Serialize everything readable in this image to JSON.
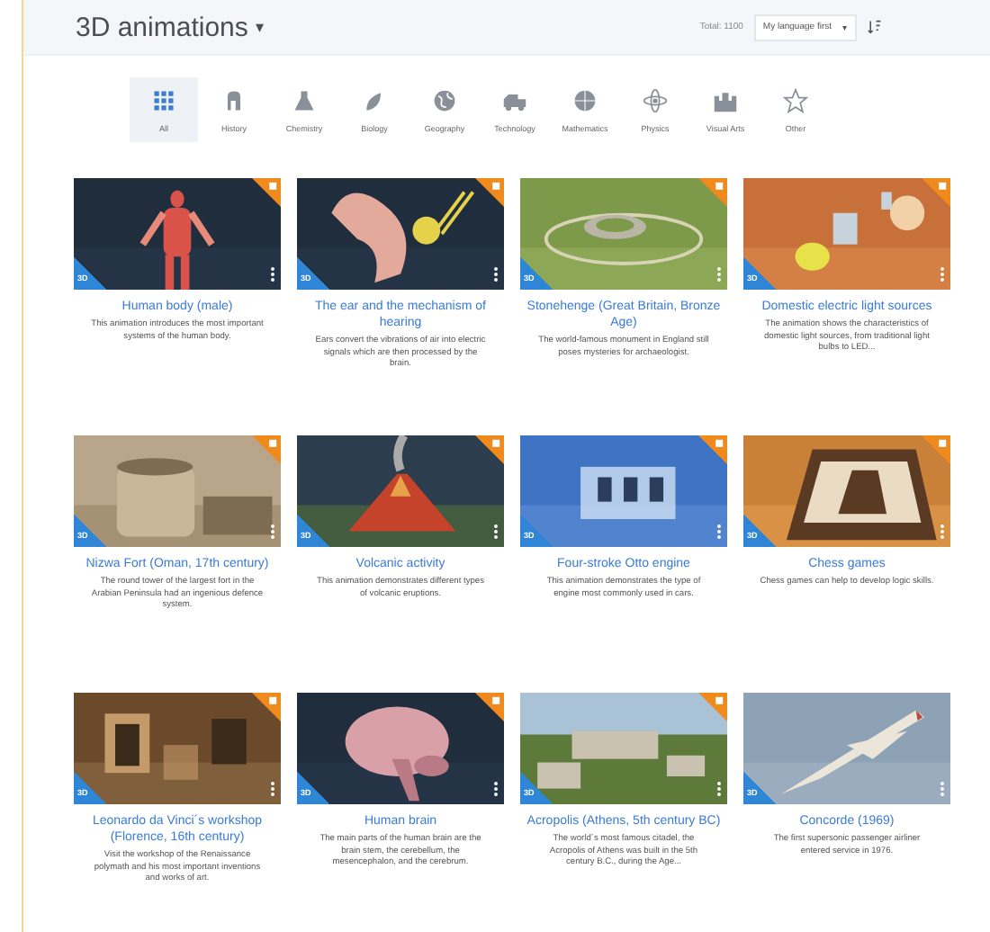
{
  "header": {
    "title": "3D animations",
    "title_caret": "▾",
    "total": "Total: 1100",
    "sort_select": {
      "value": "My language first",
      "caret": "▾"
    }
  },
  "categories": [
    {
      "label": "All",
      "selected": true
    },
    {
      "label": "History",
      "selected": false
    },
    {
      "label": "Chemistry",
      "selected": false
    },
    {
      "label": "Biology",
      "selected": false
    },
    {
      "label": "Geography",
      "selected": false
    },
    {
      "label": "Technology",
      "selected": false
    },
    {
      "label": "Mathematics",
      "selected": false
    },
    {
      "label": "Physics",
      "selected": false
    },
    {
      "label": "Visual Arts",
      "selected": false
    },
    {
      "label": "Other",
      "selected": false
    }
  ],
  "cards": [
    {
      "kind": "picture",
      "tag": "3D",
      "badge": true,
      "title": "Human body (male)",
      "description": "This animation introduces the most important systems of the human body."
    },
    {
      "kind": "picture",
      "tag": "3D",
      "badge": true,
      "title": "The ear and the mechanism of hearing",
      "description": "Ears convert the vibrations of air into electric signals which are then processed by the brain."
    },
    {
      "kind": "picture",
      "tag": "3D",
      "badge": true,
      "title": "Stonehenge (Great Britain, Bronze Age)",
      "description": "The world-famous monument in England still poses mysteries for archaeologist."
    },
    {
      "kind": "picture",
      "tag": "3D",
      "badge": true,
      "title": "Domestic electric light sources",
      "description": "The animation shows the characteristics of domestic light sources, from traditional light bulbs to LED..."
    },
    {
      "kind": "picture",
      "tag": "3D",
      "badge": true,
      "title": "Nizwa Fort (Oman, 17th century)",
      "description": "The round tower of the largest fort in the Arabian Peninsula had an ingenious defence system."
    },
    {
      "kind": "picture",
      "tag": "3D",
      "badge": true,
      "title": "Volcanic activity",
      "description": "This animation demonstrates different types of volcanic eruptions."
    },
    {
      "kind": "picture",
      "tag": "3D",
      "badge": true,
      "title": "Four-stroke Otto engine",
      "description": "This animation demonstrates the type of engine most commonly used in cars."
    },
    {
      "kind": "picture",
      "tag": "3D",
      "badge": true,
      "title": "Chess games",
      "description": "Chess games can help to develop logic skills."
    },
    {
      "kind": "picture",
      "tag": "3D",
      "badge": true,
      "title": "Leonardo da Vinci´s workshop (Florence, 16th century)",
      "description": "Visit the workshop of the Renaissance polymath and his most important inventions and works of art."
    },
    {
      "kind": "picture",
      "tag": "3D",
      "badge": true,
      "title": "Human brain",
      "description": "The main parts of the human brain are the brain stem, the cerebellum, the mesencephalon, and the cerebrum."
    },
    {
      "kind": "picture",
      "tag": "3D",
      "badge": true,
      "title": "Acropolis (Athens, 5th century BC)",
      "description": "The world´s most famous citadel, the Acropolis of Athens was built in the 5th century B.C., during the Age..."
    },
    {
      "kind": "picture",
      "tag": "3D",
      "badge": false,
      "title": "Concorde (1969)",
      "description": "The first supersonic passenger airliner entered service in 1976."
    }
  ]
}
